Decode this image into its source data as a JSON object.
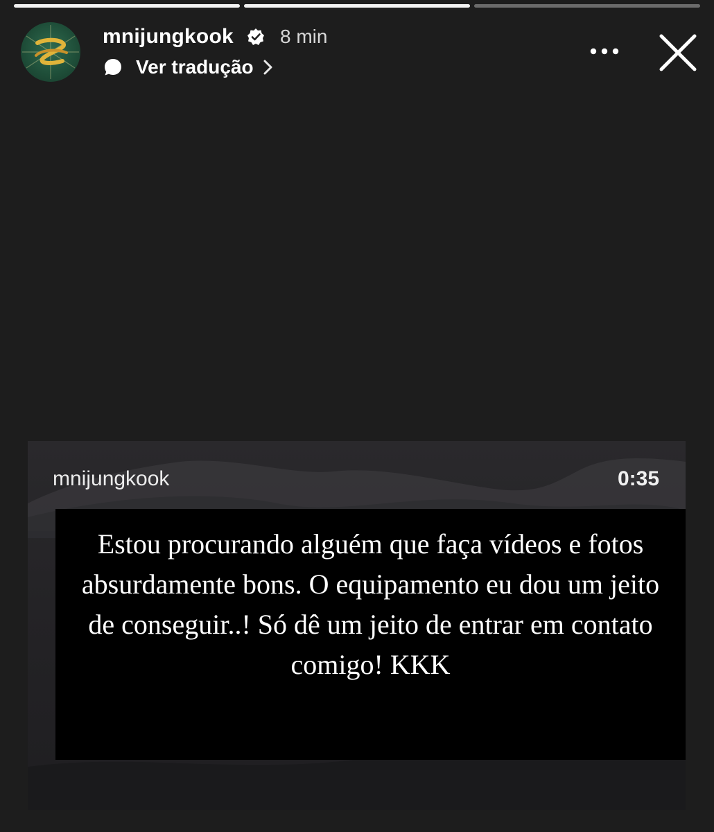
{
  "story": {
    "progress": [
      1.0,
      1.0,
      0.0
    ]
  },
  "header": {
    "username": "mnijungkook",
    "time": "8 min",
    "translate_label": "Ver tradução"
  },
  "icons": {
    "verified": "verified-badge-icon",
    "translate": "speech-bubble-icon",
    "chevron": "chevron-right-icon",
    "more": "more-options-icon",
    "close": "close-icon"
  },
  "card": {
    "username": "mnijungkook",
    "duration": "0:35",
    "caption": "Estou procurando alguém que faça vídeos e fotos absurdamente bons. O equipamento eu dou um jeito de conseguir..! Só dê um jeito de entrar em contato comigo! KKK"
  },
  "colors": {
    "background": "#1d1d1d",
    "avatar_green": "#1e4d38",
    "avatar_gold": "#e0b43a"
  }
}
